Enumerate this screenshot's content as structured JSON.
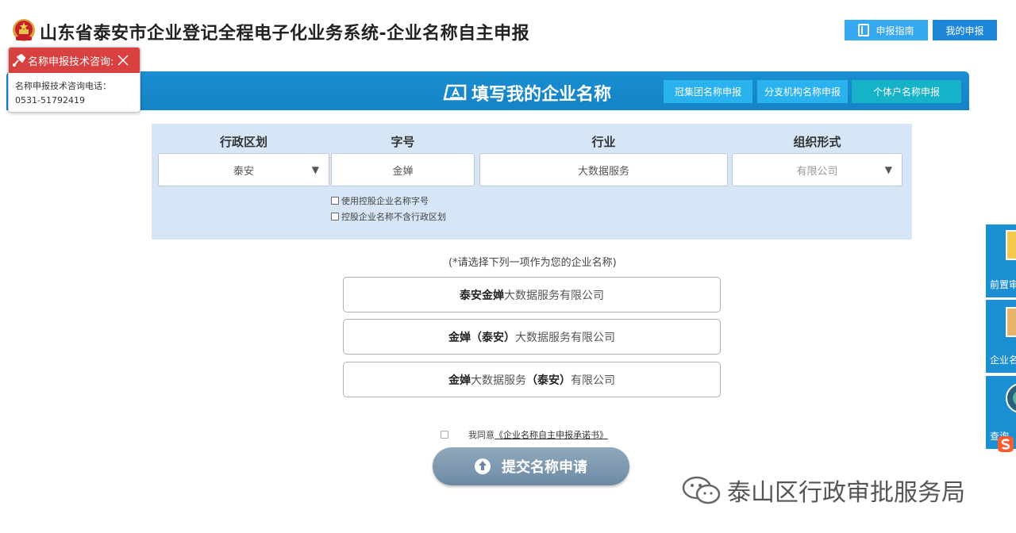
{
  "header": {
    "title": "山东省泰安市企业登记全程电子化业务系统-企业名称自主申报",
    "guide_label": "申报指南",
    "my_apply_label": "我的申报"
  },
  "consult": {
    "title": "名称申报技术咨询:",
    "line1": "名称申报技术咨询电话：",
    "phone": "0531-51792419"
  },
  "band": {
    "title": "填写我的企业名称",
    "tabs": [
      "冠集团名称申报",
      "分支机构名称申报",
      "个体户名称申报"
    ]
  },
  "form": {
    "labels": {
      "region": "行政区划",
      "brand": "字号",
      "industry": "行业",
      "org_form": "组织形式"
    },
    "values": {
      "region": "泰安",
      "brand": "金婵",
      "industry": "大数据服务",
      "org_form": "有限公司"
    },
    "checkboxes": [
      "使用控股企业名称字号",
      "控股企业名称不含行政区划"
    ]
  },
  "options": {
    "hint": "(*请选择下列一项作为您的企业名称)",
    "items": [
      {
        "bold": "泰安金婵",
        "normal_a": "大数据服务有限公司",
        "bold_b": "",
        "normal_b": ""
      },
      {
        "bold": "金婵（泰安）",
        "normal_a": "大数据服务有限公司",
        "bold_b": "",
        "normal_b": ""
      },
      {
        "bold": "金婵",
        "normal_a": "大数据服务",
        "bold_b": "（泰安）",
        "normal_b": "有限公司"
      }
    ]
  },
  "agree": {
    "prefix": "我同意",
    "link": "《企业名称自主申报承诺书》"
  },
  "submit_label": "提交名称申请",
  "side": {
    "items": [
      "前置审批",
      "企业名称",
      "查询"
    ]
  },
  "watermark": "泰山区行政审批服务局",
  "colors": {
    "band_blue": "#1a8ed1",
    "tab_cyan": "#2ab2ef",
    "panel_bg": "#d6e6f7",
    "consult_red": "#d94141",
    "submit_grey": "#7b96ad"
  }
}
